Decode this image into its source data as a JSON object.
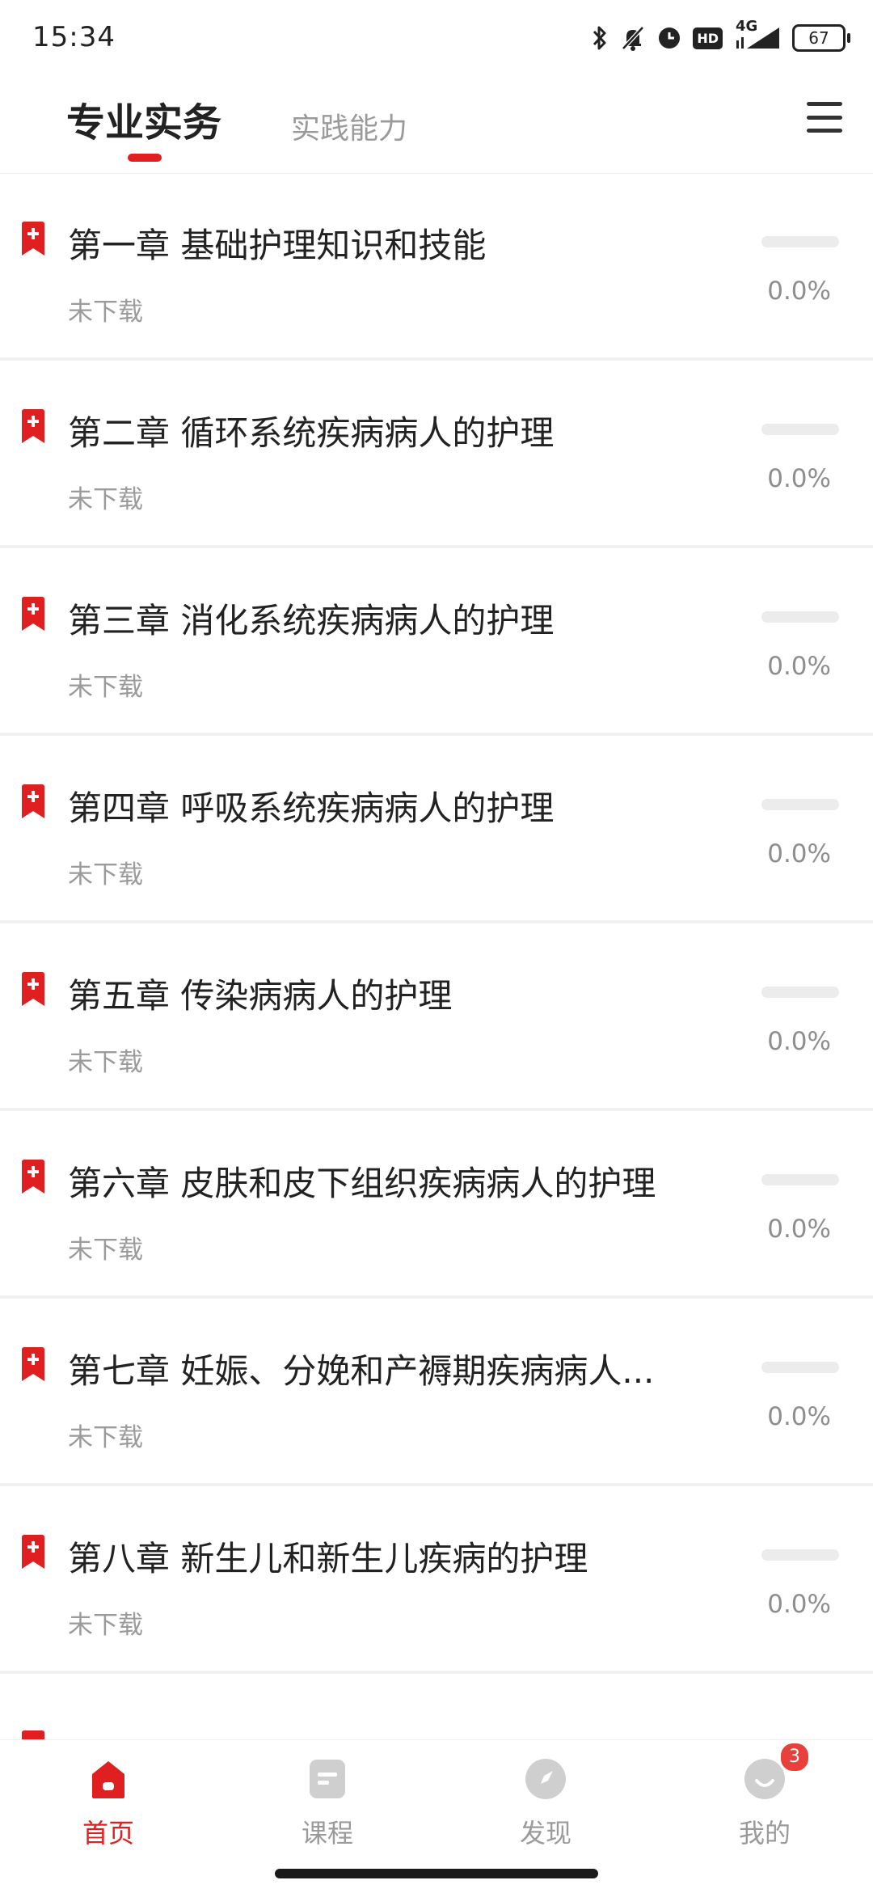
{
  "status_bar": {
    "time": "15:34",
    "network": "4G",
    "hd_label": "HD",
    "battery": "67",
    "icons": [
      "bluetooth-icon",
      "bell-muted-icon",
      "alarm-icon",
      "hd-icon",
      "signal-icon",
      "battery-icon"
    ]
  },
  "tabs": [
    {
      "label": "专业实务",
      "active": true
    },
    {
      "label": "实践能力",
      "active": false
    }
  ],
  "chapters": [
    {
      "title": "第一章 基础护理知识和技能",
      "status": "未下载",
      "progress_label": "0.0%",
      "progress": 0.0
    },
    {
      "title": "第二章 循环系统疾病病人的护理",
      "status": "未下载",
      "progress_label": "0.0%",
      "progress": 0.0
    },
    {
      "title": "第三章 消化系统疾病病人的护理",
      "status": "未下载",
      "progress_label": "0.0%",
      "progress": 0.0
    },
    {
      "title": "第四章 呼吸系统疾病病人的护理",
      "status": "未下载",
      "progress_label": "0.0%",
      "progress": 0.0
    },
    {
      "title": "第五章 传染病病人的护理",
      "status": "未下载",
      "progress_label": "0.0%",
      "progress": 0.0
    },
    {
      "title": "第六章 皮肤和皮下组织疾病病人的护理",
      "status": "未下载",
      "progress_label": "0.0%",
      "progress": 0.0
    },
    {
      "title": "第七章 妊娠、分娩和产褥期疾病病人...",
      "status": "未下载",
      "progress_label": "0.0%",
      "progress": 0.0
    },
    {
      "title": "第八章 新生儿和新生儿疾病的护理",
      "status": "未下载",
      "progress_label": "0.0%",
      "progress": 0.0
    }
  ],
  "bottom_nav": [
    {
      "label": "首页",
      "icon": "home-icon",
      "active": true
    },
    {
      "label": "课程",
      "icon": "course-icon",
      "active": false
    },
    {
      "label": "发现",
      "icon": "compass-icon",
      "active": false
    },
    {
      "label": "我的",
      "icon": "profile-icon",
      "active": false,
      "badge": "3"
    }
  ],
  "colors": {
    "accent": "#e02020",
    "muted": "#9a9a9a",
    "divider": "#f0f0f0"
  }
}
